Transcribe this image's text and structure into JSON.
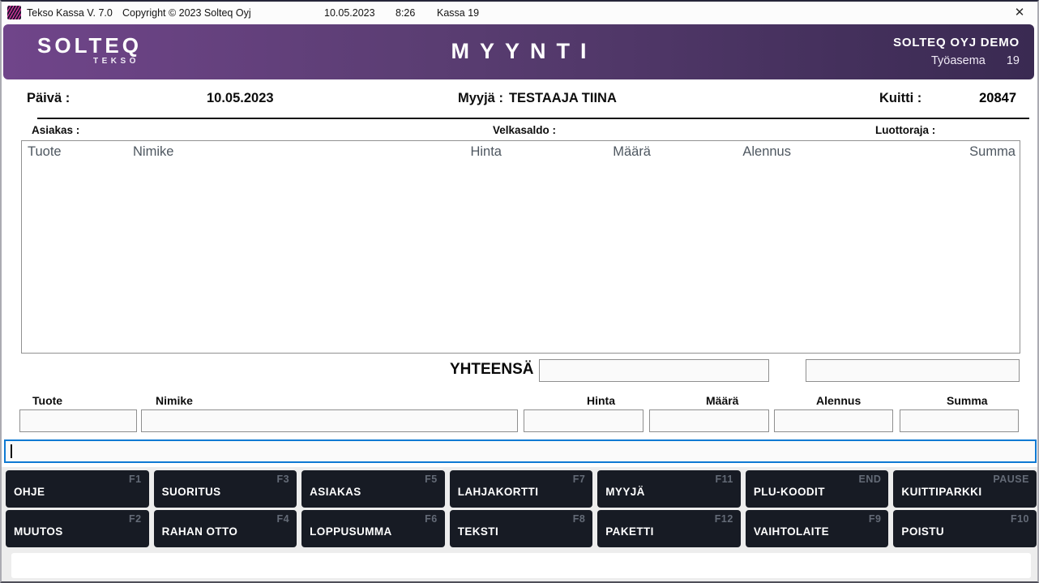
{
  "titlebar": {
    "app_title": "Tekso Kassa V. 7.0",
    "copyright": "Copyright © 2023 Solteq Oyj",
    "date": "10.05.2023",
    "time": "8:26",
    "register": "Kassa 19",
    "close_glyph": "✕"
  },
  "header": {
    "logo_primary": "SOLTEQ",
    "logo_secondary": "TEKSO",
    "screen_title": "MYYNTI",
    "company": "SOLTEQ OYJ DEMO",
    "workstation_label": "Työasema",
    "workstation_number": "19"
  },
  "info": {
    "date_label": "Päivä :",
    "date_value": "10.05.2023",
    "seller_label": "Myyjä :",
    "seller_value": "TESTAAJA TIINA",
    "receipt_label": "Kuitti :",
    "receipt_value": "20847",
    "customer_label": "Asiakas :",
    "customer_value": "",
    "debt_label": "Velkasaldo :",
    "debt_value": "",
    "credit_label": "Luottoraja :",
    "credit_value": ""
  },
  "grid": {
    "columns": [
      "Tuote",
      "Nimike",
      "Hinta",
      "Määrä",
      "Alennus",
      "Summa"
    ],
    "rows": []
  },
  "totals": {
    "label": "YHTEENSÄ",
    "total_value": "",
    "right_value": ""
  },
  "entry": {
    "fields": [
      {
        "label": "Tuote",
        "value": ""
      },
      {
        "label": "Nimike",
        "value": ""
      },
      {
        "label": "Hinta",
        "value": ""
      },
      {
        "label": "Määrä",
        "value": ""
      },
      {
        "label": "Alennus",
        "value": ""
      },
      {
        "label": "Summa",
        "value": ""
      }
    ],
    "command_value": ""
  },
  "function_keys": {
    "row1": [
      {
        "label": "OHJE",
        "key": "F1"
      },
      {
        "label": "SUORITUS",
        "key": "F3"
      },
      {
        "label": "ASIAKAS",
        "key": "F5"
      },
      {
        "label": "LAHJAKORTTI",
        "key": "F7"
      },
      {
        "label": "MYYJÄ",
        "key": "F11"
      },
      {
        "label": "PLU-KOODIT",
        "key": "END"
      },
      {
        "label": "KUITTIPARKKI",
        "key": "PAUSE"
      }
    ],
    "row2": [
      {
        "label": "MUUTOS",
        "key": "F2"
      },
      {
        "label": "RAHAN OTTO",
        "key": "F4"
      },
      {
        "label": "LOPPUSUMMA",
        "key": "F6"
      },
      {
        "label": "TEKSTI",
        "key": "F8"
      },
      {
        "label": "PAKETTI",
        "key": "F12"
      },
      {
        "label": "VAIHTOLAITE",
        "key": "F9"
      },
      {
        "label": "POISTU",
        "key": "F10"
      }
    ]
  },
  "icons": {
    "app_icon": "solteq-waves-icon",
    "close_icon": "close-icon"
  },
  "colors": {
    "header_gradient_left": "#70458a",
    "header_gradient_right": "#3a2a52",
    "function_button_bg": "#171b24",
    "function_key_text": "#646b77",
    "focus_border": "#0f7ad3",
    "grid_header_text": "#4e5760"
  }
}
